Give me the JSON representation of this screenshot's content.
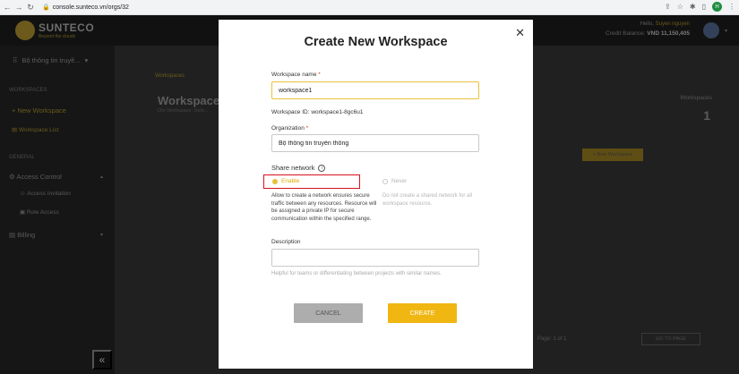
{
  "browser": {
    "url": "console.sunteco.vn/orgs/32",
    "profile_initial": "H"
  },
  "header": {
    "logo_name": "SUNTECO",
    "logo_sub": "Beyond the clouds",
    "hello_prefix": "Hello,",
    "hello_name": "Suyen nguyen",
    "credit_label": "Credit Balance:",
    "credit_value": "VND 11,150,405"
  },
  "sidebar": {
    "org_name": "Bộ thông tin truyề...",
    "section_workspaces": "WORKSPACES",
    "new_workspace": "+ New Workspace",
    "workspace_list": "Workspace List",
    "section_general": "GENERAL",
    "access_control": "Access Control",
    "access_invitation": "Access Invitation",
    "role_access": "Role Access",
    "billing": "Billing"
  },
  "background": {
    "breadcrumb": "Workspaces",
    "title": "Workspaces",
    "subtitle": "Ole Workspace: Uplo...",
    "count_label": "Workspaces",
    "count": "1",
    "new_button": "+ New Workspace",
    "pager": "Page: 1 of 1",
    "goto": "GO TO PAGE"
  },
  "modal": {
    "title": "Create New Workspace",
    "workspace_name_label": "Workspace name",
    "required_mark": "*",
    "workspace_name_value": "workspace1",
    "workspace_id_label": "Workspace ID:",
    "workspace_id_value": "workspace1-8gc6u1",
    "organization_label": "Organization",
    "organization_value": "Bộ thông tin truyền thông",
    "share_network_label": "Share network",
    "enable_label": "Enable",
    "never_label": "Never",
    "enable_description": "Allow to create a network ensures secure traffic between any resources. Resource will be assigned a private IP for secure communication within the specified range.",
    "never_description": "Do not create a shared network for all workspace resource.",
    "description_label": "Description",
    "description_value": "",
    "description_helper": "Helpful for teams or differentiating between projects with similar names.",
    "cancel_label": "CANCEL",
    "create_label": "CREATE"
  },
  "colors": {
    "accent": "#f0b612",
    "highlight": "#d7131f",
    "focus_border": "#e8c13a"
  }
}
